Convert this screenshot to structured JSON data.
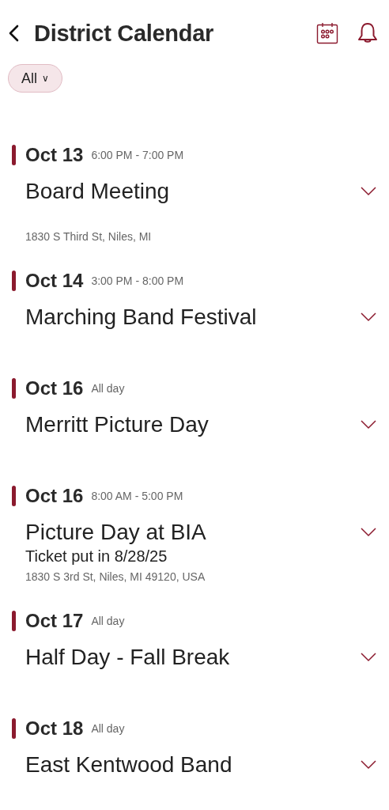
{
  "header": {
    "title": "District Calendar"
  },
  "filter": {
    "label": "All",
    "caret": "∨"
  },
  "events": [
    {
      "date": "Oct 13",
      "time": "6:00 PM - 7:00 PM",
      "title": "Board Meeting",
      "address": "1830 S Third St, Niles, MI",
      "expanded": false
    },
    {
      "date": "Oct 14",
      "time": "3:00 PM - 8:00 PM",
      "title": "Marching Band Festival",
      "expanded": false
    },
    {
      "date": "Oct 16",
      "time": "All day",
      "title": "Merritt Picture Day",
      "expanded": false
    },
    {
      "date": "Oct 16",
      "time": "8:00 AM - 5:00 PM",
      "title": "Picture Day at BIA",
      "note": "Ticket put in 8/28/25",
      "address": "1830 S 3rd St, Niles, MI 49120, USA",
      "expanded": false
    },
    {
      "date": "Oct 17",
      "time": "All day",
      "title": "Half Day - Fall Break",
      "expanded": false
    },
    {
      "date": "Oct 18",
      "time": "All day",
      "title": "East Kentwood Band",
      "expanded": false
    }
  ]
}
